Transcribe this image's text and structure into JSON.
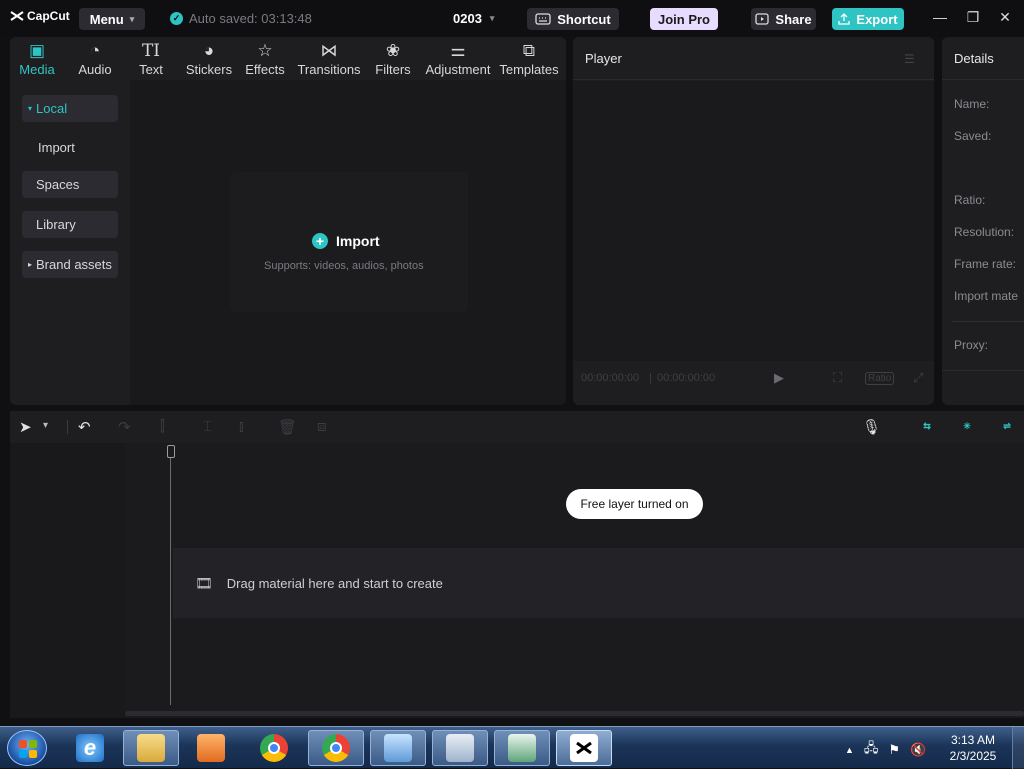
{
  "titlebar": {
    "logo": "CapCut",
    "menu_label": "Menu",
    "autosave_text": "Auto saved: 03:13:48",
    "project_name": "0203",
    "shortcut_label": "Shortcut",
    "joinpro_label": "Join Pro",
    "share_label": "Share",
    "export_label": "Export"
  },
  "media_toolbar": {
    "tabs": [
      {
        "label": "Media",
        "icon": "media-icon",
        "active": true
      },
      {
        "label": "Audio",
        "icon": "audio-icon"
      },
      {
        "label": "Text",
        "icon": "text-icon"
      },
      {
        "label": "Stickers",
        "icon": "stickers-icon"
      },
      {
        "label": "Effects",
        "icon": "effects-icon"
      },
      {
        "label": "Transitions",
        "icon": "transitions-icon"
      },
      {
        "label": "Filters",
        "icon": "filters-icon"
      },
      {
        "label": "Adjustment",
        "icon": "adjustment-icon"
      },
      {
        "label": "Templates",
        "icon": "templates-icon"
      }
    ]
  },
  "sidebar": {
    "items": [
      {
        "label": "Local",
        "active": true
      },
      {
        "label": "Import"
      },
      {
        "label": "Spaces"
      },
      {
        "label": "Library"
      },
      {
        "label": "Brand assets"
      }
    ]
  },
  "import_box": {
    "title": "Import",
    "subtitle": "Supports: videos, audios, photos"
  },
  "player": {
    "title": "Player",
    "time_current": "00:00:00:00",
    "time_total": "00:00:00:00",
    "ratio_label": "Ratio"
  },
  "details": {
    "title": "Details",
    "labels": [
      "Name:",
      "Saved:",
      "Ratio:",
      "Resolution:",
      "Frame rate:",
      "Import mate",
      "Proxy:"
    ]
  },
  "timeline": {
    "toast": "Free layer turned on",
    "drop_hint": "Drag material here and start to create"
  },
  "taskbar": {
    "time": "3:13 AM",
    "date": "2/3/2025"
  },
  "colors": {
    "accent": "#2ec4c4",
    "joinpro_bg": "#e7dcff",
    "panel_bg": "#1e1e21"
  }
}
